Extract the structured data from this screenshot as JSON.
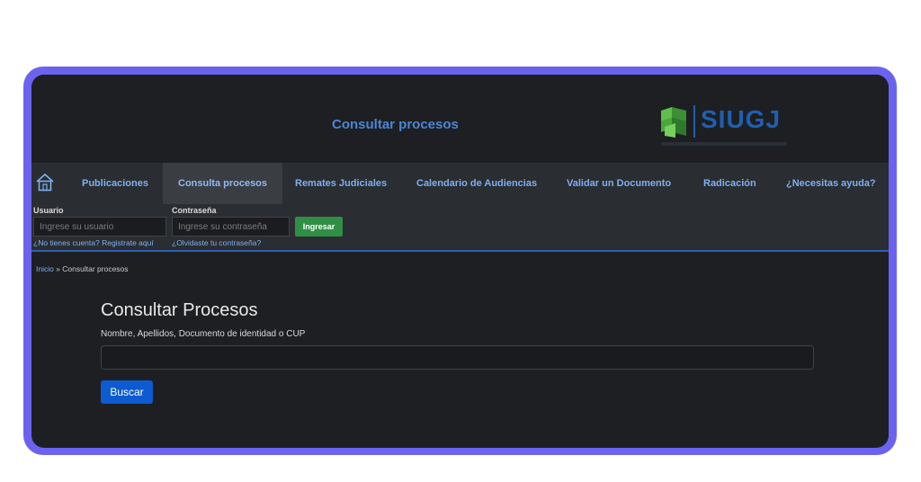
{
  "header": {
    "title": "Consultar procesos",
    "logo_text": "SIUGJ"
  },
  "nav": {
    "home_icon": "home-icon",
    "items": [
      {
        "label": "Publicaciones"
      },
      {
        "label": "Consulta procesos",
        "active": true
      },
      {
        "label": "Remates Judiciales"
      },
      {
        "label": "Calendario de Audiencias"
      },
      {
        "label": "Validar un Documento"
      },
      {
        "label": "Radicación"
      },
      {
        "label": "¿Necesitas ayuda?"
      }
    ]
  },
  "login": {
    "user_label": "Usuario",
    "user_placeholder": "Ingrese su usuario",
    "pass_label": "Contraseña",
    "pass_placeholder": "Ingrese su contraseña",
    "submit_label": "Ingresar",
    "register_link": "¿No tienes cuenta? Registrate aquí",
    "forgot_link": "¿Olvidaste tu contraseña?"
  },
  "breadcrumb": {
    "home": "Inicio",
    "separator": " » ",
    "current": "Consultar procesos"
  },
  "main": {
    "heading": "Consultar Procesos",
    "field_label": "Nombre, Apellidos, Documento de identidad o CUP",
    "search_value": "",
    "search_button": "Buscar"
  },
  "colors": {
    "frame": "#6b63f0",
    "accent_link": "#7fb0ef",
    "login_button": "#2f8f45",
    "search_button": "#0d5ad1"
  }
}
